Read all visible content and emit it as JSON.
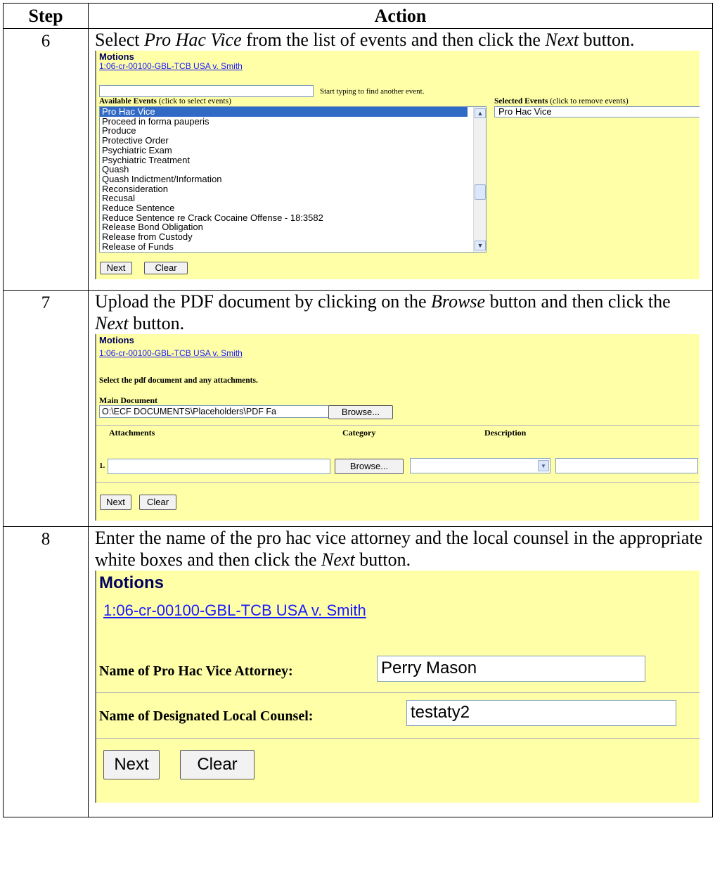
{
  "table": {
    "header_step": "Step",
    "header_action": "Action"
  },
  "steps": [
    {
      "number": "6",
      "instruction_parts": [
        "Select ",
        "Pro Hac Vice",
        " from the list of events and then click the ",
        "Next",
        " button."
      ],
      "screen": {
        "title": "Motions",
        "case_link": "1:06-cr-00100-GBL-TCB USA v. Smith",
        "search_value": "",
        "search_hint": "Start typing to find another event.",
        "available_label": "Available Events",
        "available_hint": "(click to select events)",
        "selected_label": "Selected Events",
        "selected_hint": "(click to remove events)",
        "events": [
          "Pro Hac Vice",
          "Proceed in forma pauperis",
          "Produce",
          "Protective Order",
          "Psychiatric Exam",
          "Psychiatric Treatment",
          "Quash",
          "Quash Indictment/Information",
          "Reconsideration",
          "Recusal",
          "Reduce Sentence",
          "Reduce Sentence re Crack Cocaine Offense - 18:3582",
          "Release Bond Obligation",
          "Release from Custody",
          "Release of Funds"
        ],
        "highlighted_event": "Pro Hac Vice",
        "selected_events": [
          "Pro Hac Vice"
        ],
        "next_label": "Next",
        "clear_label": "Clear"
      }
    },
    {
      "number": "7",
      "instruction_parts": [
        "Upload the PDF document by clicking on the ",
        "Browse",
        " button and then click the ",
        "Next",
        " button."
      ],
      "screen": {
        "title": "Motions",
        "case_link": "1:06-cr-00100-GBL-TCB USA v. Smith",
        "instructions": "Select the pdf document and any attachments.",
        "main_document_label": "Main Document",
        "main_document_value": "O:\\ECF DOCUMENTS\\Placeholders\\PDF Fa",
        "browse_label": "Browse...",
        "col_attachments": "Attachments",
        "col_category": "Category",
        "col_description": "Description",
        "row_number": "1.",
        "next_label": "Next",
        "clear_label": "Clear"
      }
    },
    {
      "number": "8",
      "instruction": "Enter the name of the pro hac vice attorney and the local counsel in the appropriate white boxes and then click the ",
      "instruction_em": "Next",
      "instruction_end": " button.",
      "screen": {
        "title": "Motions",
        "case_link": "1:06-cr-00100-GBL-TCB USA v. Smith",
        "attorney_label": "Name of Pro Hac Vice Attorney:",
        "attorney_value": "Perry Mason",
        "counsel_label": "Name of Designated Local Counsel:",
        "counsel_value": "testaty2",
        "next_label": "Next",
        "clear_label": "Clear"
      }
    }
  ]
}
